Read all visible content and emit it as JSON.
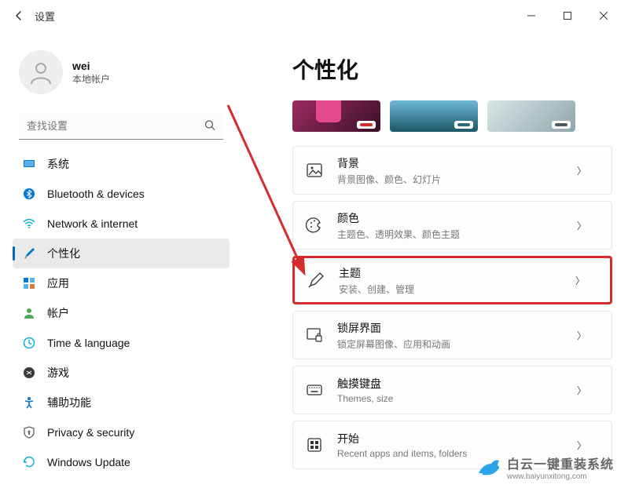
{
  "window": {
    "title": "设置"
  },
  "user": {
    "name": "wei",
    "sub": "本地帐户"
  },
  "search": {
    "placeholder": "查找设置"
  },
  "nav": [
    {
      "label": "系统"
    },
    {
      "label": "Bluetooth & devices"
    },
    {
      "label": "Network & internet"
    },
    {
      "label": "个性化"
    },
    {
      "label": "应用"
    },
    {
      "label": "帐户"
    },
    {
      "label": "Time & language"
    },
    {
      "label": "游戏"
    },
    {
      "label": "辅助功能"
    },
    {
      "label": "Privacy & security"
    },
    {
      "label": "Windows Update"
    }
  ],
  "page": {
    "title": "个性化"
  },
  "thumbs": {
    "accent1": "#d52b2b",
    "accent2": "#2d6a7a",
    "accent3": "#4a5c63"
  },
  "cards": [
    {
      "title": "背景",
      "sub": "背景图像、颜色、幻灯片"
    },
    {
      "title": "颜色",
      "sub": "主题色、透明效果、颜色主题"
    },
    {
      "title": "主题",
      "sub": "安装、创建、管理"
    },
    {
      "title": "锁屏界面",
      "sub": "锁定屏幕图像、应用和动画"
    },
    {
      "title": "触摸键盘",
      "sub": "Themes, size"
    },
    {
      "title": "开始",
      "sub": "Recent apps and items, folders"
    }
  ],
  "watermark": {
    "cn": "白云一键重装系统",
    "url": "www.baiyunxitong.com"
  }
}
